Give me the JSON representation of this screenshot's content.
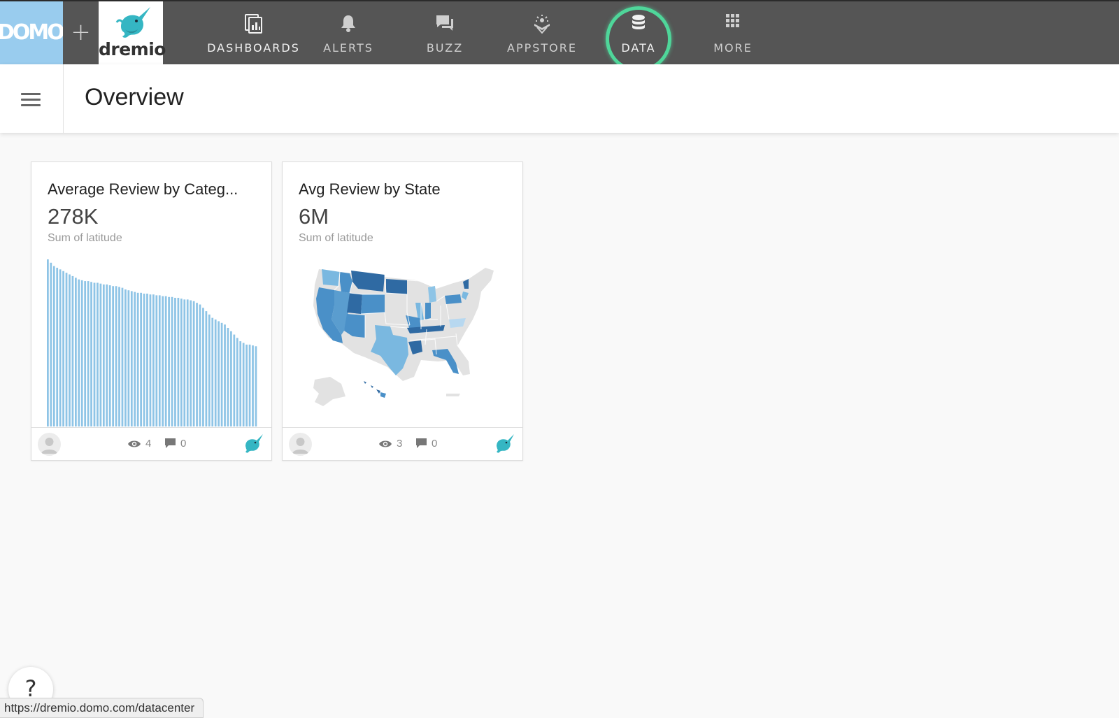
{
  "topbar": {
    "domo_logo": "DOMO",
    "add_label": "+",
    "brand_logo": "dremio",
    "nav": [
      {
        "label": "DASHBOARDS",
        "icon": "dashboards-icon"
      },
      {
        "label": "ALERTS",
        "icon": "bell-icon"
      },
      {
        "label": "BUZZ",
        "icon": "chat-icon"
      },
      {
        "label": "APPSTORE",
        "icon": "appstore-icon"
      },
      {
        "label": "DATA",
        "icon": "database-icon"
      },
      {
        "label": "MORE",
        "icon": "grid-icon"
      }
    ]
  },
  "header": {
    "title": "Overview"
  },
  "cards": [
    {
      "title": "Average Review by Categ...",
      "summary": "278K",
      "summary_label": "Sum of latitude",
      "views": "4",
      "comments": "0",
      "chart_data": {
        "type": "bar",
        "color": "#8ec4e6",
        "ylim": [
          0,
          100
        ],
        "values": [
          100,
          98,
          96,
          95,
          94,
          93,
          92,
          91,
          90,
          89,
          88,
          87.5,
          87,
          87,
          86.5,
          86,
          86,
          85.5,
          85,
          85,
          84.5,
          84,
          84,
          83.5,
          83,
          82,
          81.5,
          81,
          80.5,
          80,
          80,
          79.5,
          79.5,
          79,
          79,
          78.5,
          78.5,
          78,
          78,
          77.5,
          77.5,
          77,
          77,
          76.5,
          76,
          76,
          75.5,
          75,
          74,
          73,
          71,
          69,
          67,
          65,
          64,
          63,
          62,
          61,
          59,
          57,
          55,
          53,
          51,
          50,
          49,
          49,
          48.5,
          48
        ]
      }
    },
    {
      "title": "Avg Review by State",
      "summary": "6M",
      "summary_label": "Sum of latitude",
      "views": "3",
      "comments": "0"
    }
  ],
  "help": {
    "label": "?"
  },
  "status_url": "https://dremio.domo.com/datacenter"
}
